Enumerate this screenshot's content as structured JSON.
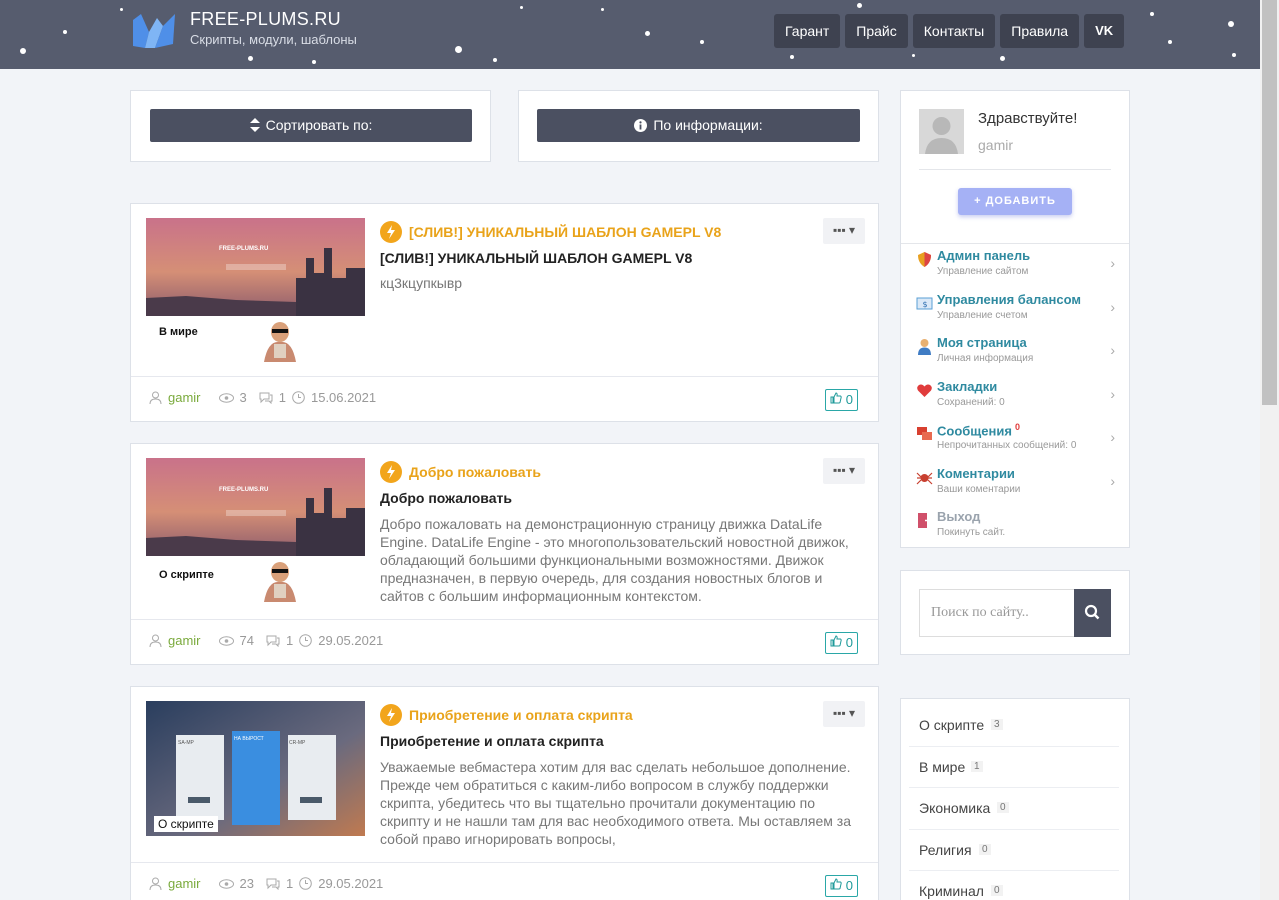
{
  "header": {
    "site_name": "FREE-PLUMS.RU",
    "tagline": "Скрипты, модули, шаблоны",
    "nav": [
      "Гарант",
      "Прайс",
      "Контакты",
      "Правила"
    ],
    "vk_label": "VK"
  },
  "sort_bar": {
    "sort_label": "Сортировать по:",
    "info_label": "По информации:"
  },
  "posts": [
    {
      "title": "[СЛИВ!] УНИКАЛЬНЫЙ ШАБЛОН GAMEPL V8",
      "heading": "[СЛИВ!] УНИКАЛЬНЫЙ ШАБЛОН GAMEPL V8",
      "text": "кц3кцупкывр",
      "thumb_site": "FREE-PLUMS.RU",
      "thumb_label": "В мире",
      "author": "gamir",
      "views": "3",
      "comments": "1",
      "date": "15.06.2021",
      "likes": "0"
    },
    {
      "title": "Добро пожаловать",
      "heading": "Добро пожаловать",
      "text": "Добро пожаловать на демонстрационную страницу движка DataLife Engine. DataLife Engine - это многопользовательский новостной движок, обладающий большими функциональными возможностями. Движок предназначен, в первую очередь, для создания новостных блогов и сайтов с большим информационным контекстом.",
      "thumb_site": "FREE-PLUMS.RU",
      "thumb_label": "О скрипте",
      "author": "gamir",
      "views": "74",
      "comments": "1",
      "date": "29.05.2021",
      "likes": "0"
    },
    {
      "title": "Приобретение и оплата скрипта",
      "heading": "Приобретение и оплата скрипта",
      "text": "Уважаемые вебмастера хотим для вас сделать небольшое дополнение. Прежде чем обратиться с каким-либо вопросом в службу поддержки скрипта, убедитесь что вы тщательно прочитали документацию по скрипту и не нашли там для вас необходимого ответа. Мы оставляем за собой право игнорировать вопросы,",
      "thumb_site": "",
      "thumb_label": "О скрипте",
      "thumb_plans": [
        "SA-MP",
        "НА ВЫРОСТ",
        "CR-MP"
      ],
      "author": "gamir",
      "views": "23",
      "comments": "1",
      "date": "29.05.2021",
      "likes": "0"
    }
  ],
  "user_panel": {
    "greeting": "Здравствуйте!",
    "username": "gamir",
    "add_label": "+ ДОБАВИТЬ",
    "menu": [
      {
        "title": "Админ панель",
        "sub": "Управление сайтом",
        "icon": "shield-icon",
        "color": "#e8a020"
      },
      {
        "title": "Управления балансом",
        "sub": "Управление счетом",
        "icon": "balance-icon",
        "color": "#5a9fd4"
      },
      {
        "title": "Моя страница",
        "sub": "Личная информация",
        "icon": "user-icon",
        "color": "#3f7cc4"
      },
      {
        "title": "Закладки",
        "sub": "Сохранений: 0",
        "icon": "heart-icon",
        "color": "#e03c3c"
      },
      {
        "title": "Сообщения",
        "sub": "Непрочитанных сообщений: 0",
        "badge": "0",
        "icon": "messages-icon",
        "color": "#d84030"
      },
      {
        "title": "Коментарии",
        "sub": "Ваши коментарии",
        "icon": "spider-icon",
        "color": "#c84030"
      },
      {
        "title": "Выход",
        "sub": "Покинуть сайт.",
        "icon": "exit-icon",
        "color": "#d0506a"
      }
    ]
  },
  "search": {
    "placeholder": "Поиск по сайту.."
  },
  "categories": [
    {
      "name": "О скрипте",
      "count": "3"
    },
    {
      "name": "В мире",
      "count": "1"
    },
    {
      "name": "Экономика",
      "count": "0"
    },
    {
      "name": "Религия",
      "count": "0"
    },
    {
      "name": "Криминал",
      "count": "0"
    }
  ]
}
